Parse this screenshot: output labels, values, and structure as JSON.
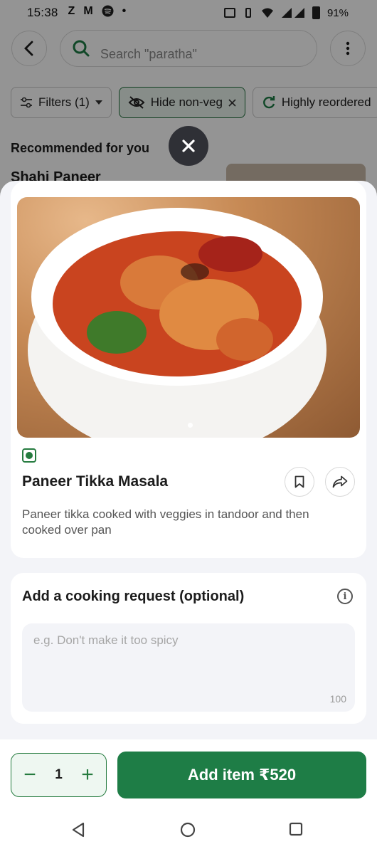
{
  "status_bar": {
    "time": "15:38",
    "notif_icons": [
      "Z",
      "M",
      "spotify-icon",
      "dot"
    ],
    "battery": "91%"
  },
  "header": {
    "search_placeholder": "Search \"paratha\""
  },
  "filters": [
    {
      "label": "Filters (1)",
      "icon": "sliders-icon",
      "trailing": "caret-down-icon"
    },
    {
      "label": "Hide non-veg",
      "icon": "eye-off-icon",
      "trailing": "close-icon",
      "active": true
    },
    {
      "label": "Highly reordered",
      "icon": "refresh-icon"
    }
  ],
  "background_list": {
    "section_title": "Recommended for you",
    "first_item": "Shahi Paneer"
  },
  "dish": {
    "veg": true,
    "name": "Paneer Tikka Masala",
    "description": "Paneer tikka cooked with veggies in tandoor and then cooked over pan",
    "image_dots": 1
  },
  "cooking_request": {
    "title": "Add a cooking request (optional)",
    "placeholder": "e.g. Don't make it too spicy",
    "char_limit": "100"
  },
  "cart": {
    "quantity": "1",
    "minus": "−",
    "plus": "+",
    "add_label": "Add item ₹520"
  },
  "colors": {
    "brand_green": "#1e7d46",
    "veg_green": "#257b3f",
    "sheet_bg": "#f3f4f8"
  }
}
